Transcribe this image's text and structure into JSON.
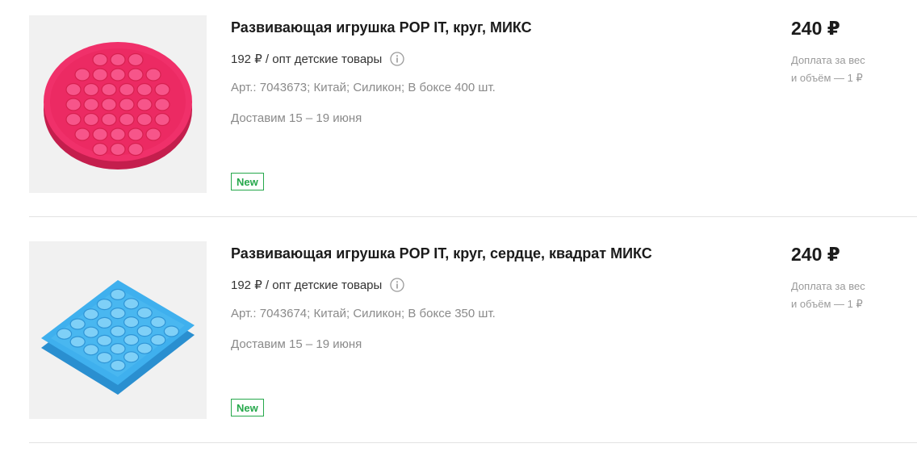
{
  "products": [
    {
      "title": "Развивающая игрушка POP IT, круг, МИКС",
      "opt_price": "192 ₽ / опт детские товары",
      "specs": "Арт.: 7043673; Китай;  Силикон;  В боксе 400 шт.",
      "delivery": "Доставим 15 – 19 июня",
      "badge": "New",
      "price": "240 ₽",
      "surcharge_line1": "Доплата за вес",
      "surcharge_line2": "и объём — 1 ₽",
      "image_icon": "pop-it-round-pink",
      "image_color": "#f0306a"
    },
    {
      "title": "Развивающая игрушка POP IT, круг, сердце, квадрат МИКС",
      "opt_price": "192 ₽ / опт детские товары",
      "specs": "Арт.: 7043674; Китай;  Силикон;  В боксе 350 шт.",
      "delivery": "Доставим 15 – 19 июня",
      "badge": "New",
      "price": "240 ₽",
      "surcharge_line1": "Доплата за вес",
      "surcharge_line2": "и объём — 1 ₽",
      "image_icon": "pop-it-square-blue",
      "image_color": "#3fb0ee"
    }
  ],
  "colors": {
    "badge_green": "#26a84b",
    "muted_text": "#8a8a8a",
    "divider": "#e2e2e2"
  }
}
